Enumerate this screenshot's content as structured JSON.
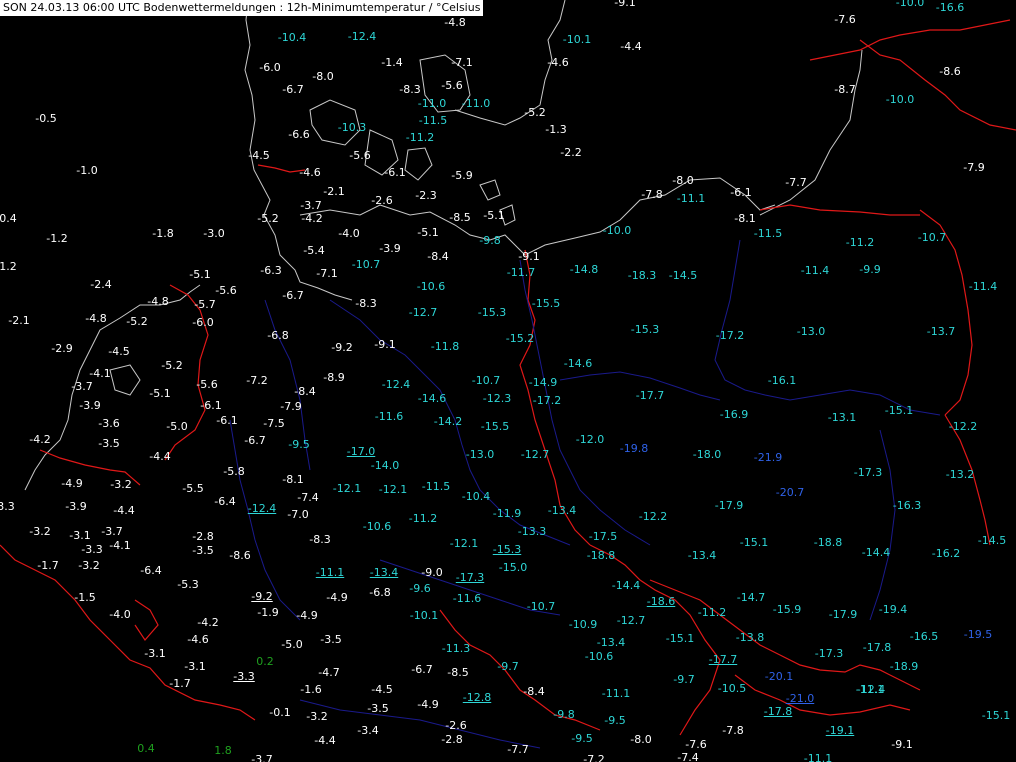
{
  "header": {
    "title": "SON 24.03.13 06:00 UTC  Bodenwettermeldungen :  12h-Minimumtemperatur / °Celsius"
  },
  "colors": {
    "background": "#000000",
    "coastline": "#c8c8c8",
    "border": "#e01818",
    "river": "#1a1a8c",
    "value_warm": "#ffffff",
    "value_cold": "#2ed6d6",
    "value_very_cold": "#2f62e8",
    "value_positive": "#1fa01f"
  },
  "stations": [
    "-9.1",
    "-10.0",
    "-16.6",
    "-4.8",
    "-7.6",
    "-10.4",
    "-12.4",
    "-10.1",
    "-4.4",
    "-6.0",
    "-8.0",
    "-1.4",
    "-7.1",
    "-4.6",
    "-8.6",
    "-6.7",
    "-8.3",
    "-5.6",
    "-8.7",
    "-10.0",
    "-11.0",
    "-11.0",
    "-5.2",
    "-0.5",
    "-10.3",
    "-11.5",
    "-1.3",
    "-6.6",
    "-11.2",
    "-2.2",
    "-4.5",
    "-5.6",
    "-7.9",
    "-1.0",
    "-4.6",
    "-6.1",
    "-5.9",
    "-8.0",
    "-2.1",
    "-2.3",
    "-7.7",
    "-6.1",
    "-7.8",
    "-11.1",
    "-3.7",
    "-2.6",
    "-8.5",
    "-5.1",
    "0.4",
    "-5.2",
    "-4.2",
    "-8.1",
    "-1.2",
    "-1.8",
    "-3.0",
    "-4.0",
    "-5.1",
    "-10.0",
    "-11.5",
    "-9.8",
    "-11.2",
    "-10.7",
    "-5.4",
    "-3.9",
    "-8.4",
    "-9.1",
    "1.2",
    "-10.7",
    "-14.8",
    "-11.4",
    "-9.9",
    "-6.3",
    "-7.1",
    "-11.7",
    "-18.3",
    "-14.5",
    "-5.1",
    "-2.4",
    "-5.6",
    "-11.4",
    "-4.8",
    "-5.7",
    "-6.7",
    "-10.6",
    "-8.3",
    "-15.5",
    "-12.7",
    "-15.3",
    "-2.1",
    "-4.8",
    "-5.2",
    "-6.0",
    "-15.3",
    "-13.0",
    "-13.7",
    "-6.8",
    "-15.2",
    "-17.2",
    "-9.2",
    "-9.1",
    "-11.8",
    "-2.9",
    "-4.5",
    "-14.6",
    "-4.1",
    "-5.2",
    "-8.9",
    "-16.1",
    "-10.7",
    "-14.9",
    "-3.7",
    "-5.6",
    "-7.2",
    "-12.4",
    "-17.7",
    "-15.1",
    "-8.4",
    "-5.1",
    "-14.6",
    "-12.3",
    "-17.2",
    "-13.1",
    "-3.9",
    "-6.1",
    "-7.9",
    "-16.9",
    "-11.6",
    "-14.2",
    "-3.6",
    "-6.1",
    "-7.5",
    "-5.0",
    "-15.5",
    "-12.2",
    "-4.2",
    "-12.7",
    "-12.0",
    "-6.7",
    "-9.5",
    "-17.0",
    "-3.5",
    "-19.8",
    "-13.0",
    "-18.0",
    "-21.9",
    "-4.4",
    "-14.0",
    "-17.3",
    "-5.8",
    "-13.2",
    "-8.1",
    "-4.9",
    "-3.2",
    "-20.7",
    "-5.5",
    "-12.1",
    "-12.1",
    "-11.5",
    "-7.4",
    "-6.4",
    "-10.4",
    "-3.3",
    "-3.9",
    "-17.9",
    "-16.3",
    "-4.4",
    "-12.4",
    "-11.9",
    "-7.0",
    "-13.4",
    "-3.7",
    "-10.6",
    "-11.2",
    "-12.2",
    "-3.2",
    "-3.1",
    "-17.5",
    "-8.3",
    "-14.5",
    "-4.1",
    "-15.1",
    "-2.8",
    "-12.1",
    "-18.8",
    "-3.3",
    "-3.5",
    "-8.6",
    "-15.3",
    "-14.4",
    "-16.2",
    "-13.3",
    "-1.7",
    "-3.2",
    "-18.8",
    "-13.4",
    "-6.4",
    "-15.0",
    "-11.1",
    "-13.4",
    "-9.0",
    "-17.3",
    "-5.3",
    "-14.4",
    "-6.8",
    "-9.6",
    "-1.5",
    "-9.2",
    "-11.6",
    "-14.7",
    "-18.6",
    "-4.9",
    "-10.7",
    "-15.9",
    "-19.4",
    "-4.2",
    "-1.9",
    "-10.1",
    "-11.2",
    "-17.9",
    "-12.7",
    "-4.0",
    "-10.9",
    "-4.9",
    "-19.5",
    "-16.5",
    "-4.6",
    "-5.0",
    "-3.5",
    "-13.4",
    "-13.8",
    "-15.1",
    "-11.3",
    "-17.8",
    "-3.1",
    "-10.6",
    "-17.3",
    "-18.9",
    "-3.1",
    "0.2",
    "-4.7",
    "-9.7",
    "-6.7",
    "-17.7",
    "-8.5",
    "-20.1",
    "-9.7",
    "-3.3",
    "-11.1",
    "-1.7",
    "-1.6",
    "-4.5",
    "-10.5",
    "-12.4",
    "-8.4",
    "-12.8",
    "-21.0",
    "-3.5",
    "-17.8",
    "-0.1",
    "-4.9",
    "-3.2",
    "-15.1",
    "-9.8",
    "-11.1",
    "-9.5",
    "-2.6",
    "-19.1",
    "-3.4",
    "-7.8",
    "-9.5",
    "-8.0",
    "-2.8",
    "-4.4",
    "-9.1",
    "0.4",
    "1.8",
    "-7.6",
    "-7.7",
    "-7.4",
    "-3.7",
    "-7.2",
    "-11.1"
  ]
}
